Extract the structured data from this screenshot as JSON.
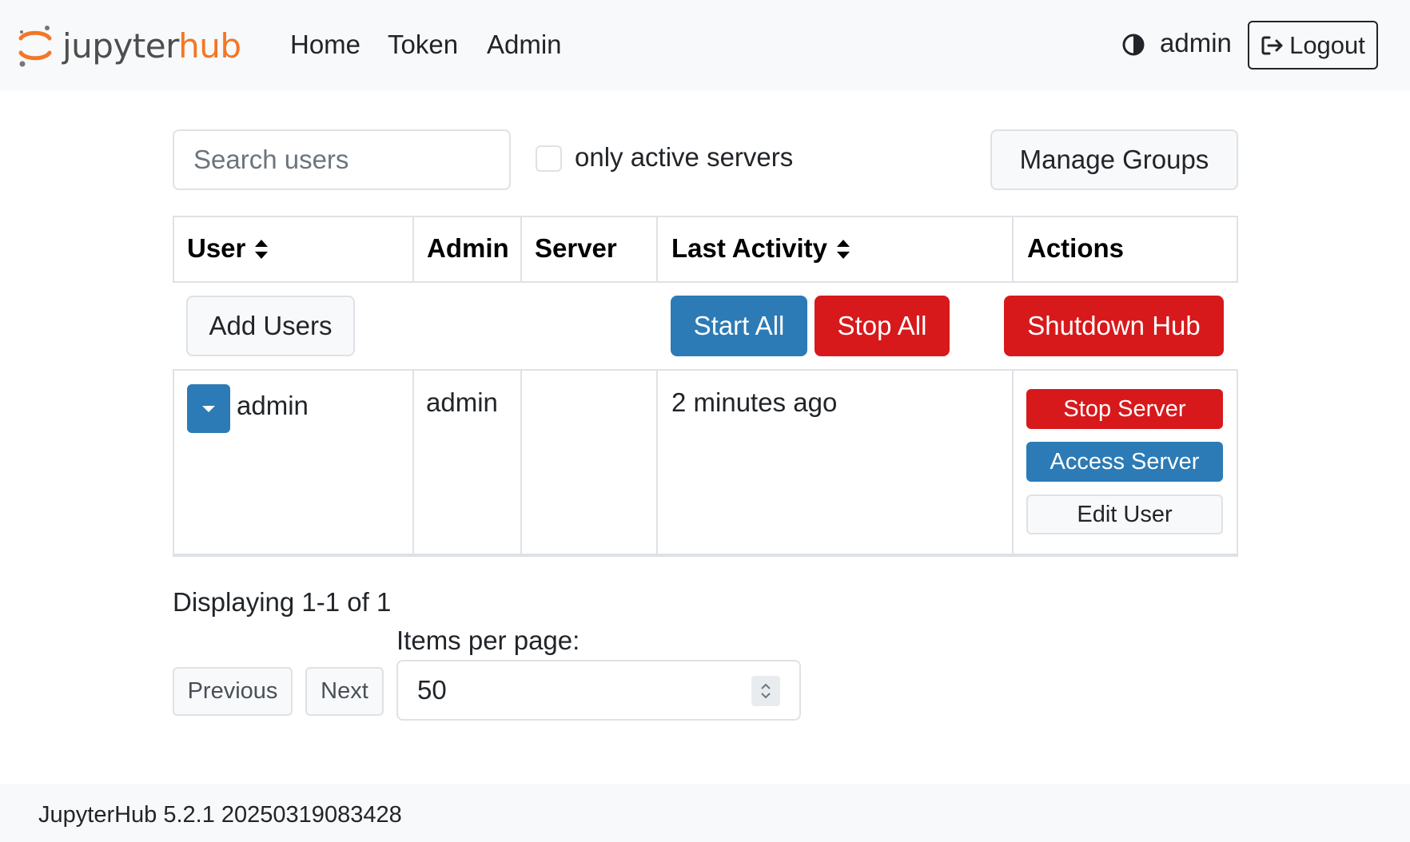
{
  "navbar": {
    "brand_jupyter": "jupyter",
    "brand_hub": "hub",
    "links": [
      "Home",
      "Token",
      "Admin"
    ],
    "theme_icon": "contrast-icon",
    "username": "admin",
    "logout_label": "Logout",
    "logout_icon": "sign-out-icon"
  },
  "controls": {
    "search_placeholder": "Search users",
    "search_value": "",
    "only_active_label": "only active servers",
    "only_active_checked": false,
    "manage_groups_label": "Manage Groups"
  },
  "table": {
    "headers": [
      "User",
      "Admin",
      "Server",
      "Last Activity",
      "Actions"
    ],
    "sortable": [
      "User",
      "Last Activity"
    ],
    "bulk": {
      "add_users": "Add Users",
      "start_all": "Start All",
      "stop_all": "Stop All",
      "shutdown_hub": "Shutdown Hub"
    },
    "rows": [
      {
        "user": "admin",
        "admin": "admin",
        "server": "",
        "last_activity": "2 minutes ago",
        "actions": [
          "Stop Server",
          "Access Server",
          "Edit User"
        ]
      }
    ]
  },
  "pagination": {
    "displaying": "Displaying 1-1 of 1",
    "previous": "Previous",
    "next": "Next",
    "items_per_page_label": "Items per page:",
    "items_per_page_value": "50"
  },
  "footer": {
    "version": "JupyterHub 5.2.1 20250319083428"
  },
  "colors": {
    "primary": "#2c7bb6",
    "danger": "#d7191c",
    "brand_orange": "#f37726",
    "navbar_bg": "#f8f9fa"
  }
}
